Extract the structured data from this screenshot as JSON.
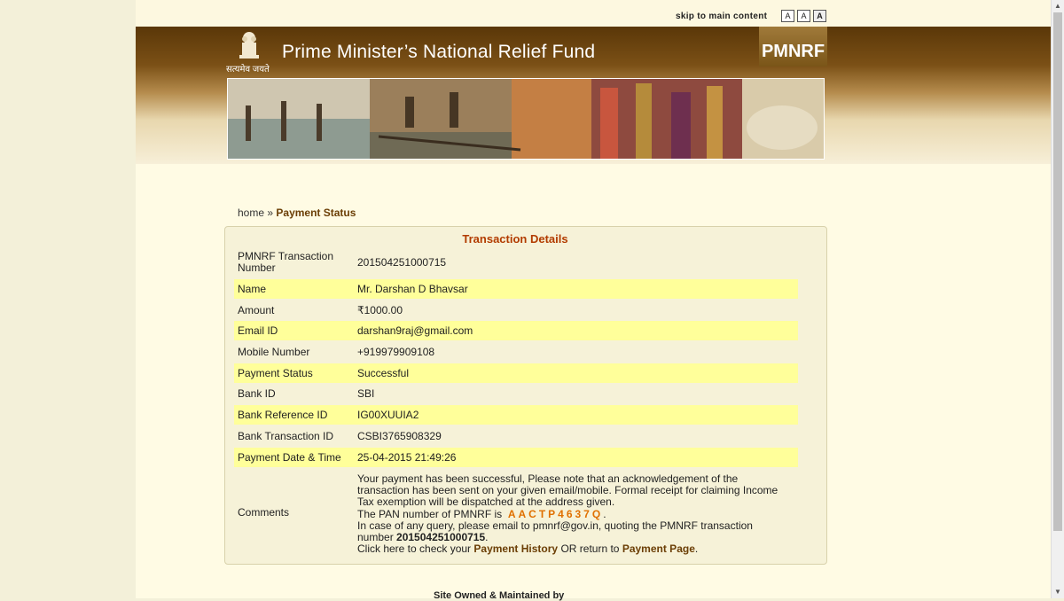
{
  "topbar": {
    "skip_label": "skip to main content",
    "font_sizes": [
      "A",
      "A",
      "A"
    ]
  },
  "header": {
    "motto": "सत्यमेव जयते",
    "title": "Prime Minister’s National Relief Fund",
    "logo": "PMNRF"
  },
  "breadcrumb": {
    "home": "home",
    "sep": "»",
    "current": "Payment Status"
  },
  "transaction": {
    "title": "Transaction Details",
    "txn_label": "PMNRF Transaction Number",
    "txn_value": "201504251000715",
    "rows": [
      {
        "label": "Name",
        "value": "Mr. Darshan D Bhavsar"
      },
      {
        "label": "Amount",
        "value": "₹1000.00"
      },
      {
        "label": "Email ID",
        "value": "darshan9raj@gmail.com"
      },
      {
        "label": "Mobile Number",
        "value": "+919979909108"
      },
      {
        "label": "Payment Status",
        "value": "Successful"
      },
      {
        "label": "Bank ID",
        "value": "SBI"
      },
      {
        "label": "Bank Reference ID",
        "value": "IG00XUUIA2"
      },
      {
        "label": "Bank Transaction ID",
        "value": "CSBI3765908329"
      },
      {
        "label": "Payment Date & Time",
        "value": "25-04-2015 21:49:26"
      }
    ],
    "comments_label": "Comments",
    "comments": {
      "line1": "Your payment has been successful, Please note that an acknowledgement of the transaction has been sent on your given email/mobile. Formal receipt for claiming Income Tax exemption will be dispatched at the address given.",
      "pan_prefix": "The PAN number of PMNRF is",
      "pan": "AACTP4637Q",
      "pan_suffix": ".",
      "query": "In case of any query, please email to pmnrf@gov.in, quoting the PMNRF transaction number",
      "txn": "201504251000715",
      "txn_suffix": ".",
      "click_prefix": "Click here to check your",
      "history_link": "Payment History",
      "or_text": "OR return to",
      "payment_link": "Payment Page",
      "end": "."
    }
  },
  "footer": {
    "text": "Site Owned & Maintained by"
  }
}
